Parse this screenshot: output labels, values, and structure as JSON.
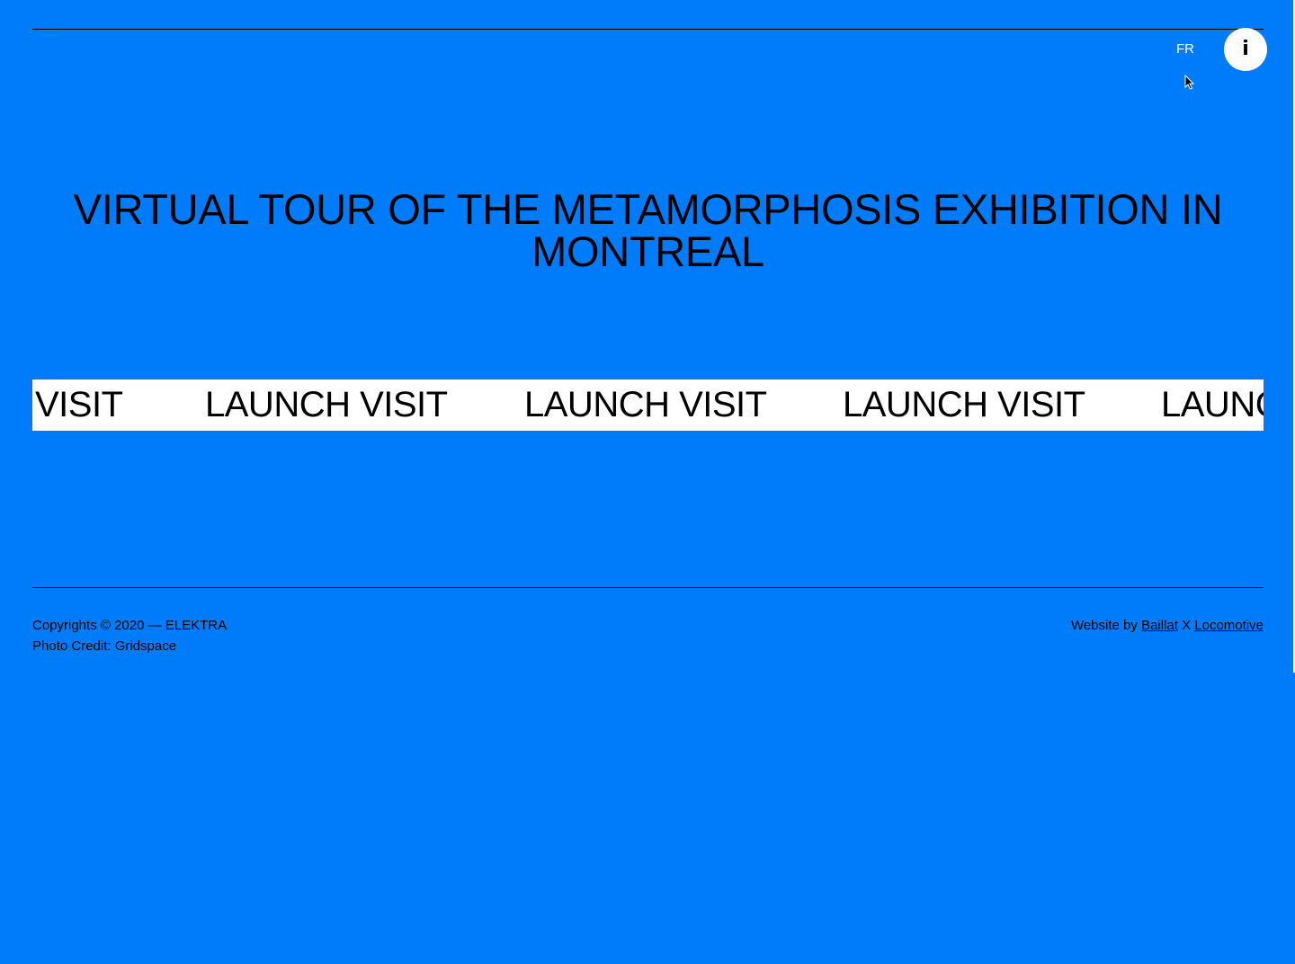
{
  "header": {
    "language_toggle": "FR",
    "info_button_label": "i"
  },
  "main": {
    "title": "VIRTUAL TOUR OF THE METAMORPHOSIS EXHIBITION IN MONTREAL",
    "marquee": {
      "items": [
        "VISIT",
        "LAUNCH VISIT",
        "LAUNCH VISIT",
        "LAUNCH VISIT",
        "LAUNC"
      ]
    }
  },
  "footer": {
    "copyright": "Copyrights © 2020 — ELEKTRA",
    "photo_credit": "Photo Credit: Gridspace",
    "website_by_prefix": "Website by",
    "credit_link_1": "Baillat",
    "separator": "X",
    "credit_link_2": "Locomotive"
  },
  "colors": {
    "background": "#007CFA",
    "marquee_background": "#FFFFFF",
    "text": "#000000"
  },
  "icons": {
    "info": "info-icon",
    "cursor": "mouse-pointer-icon"
  }
}
